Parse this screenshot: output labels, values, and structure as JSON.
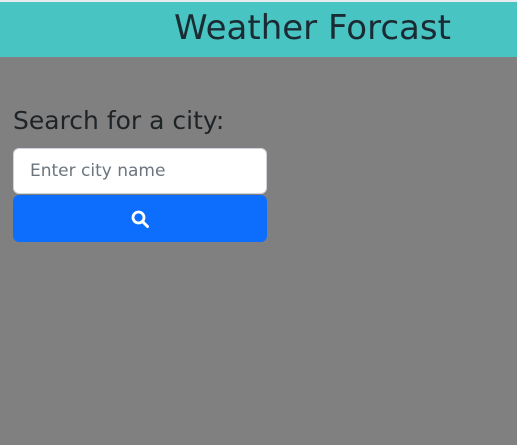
{
  "header": {
    "title": "Weather Forcast"
  },
  "search": {
    "label": "Search for a city:",
    "placeholder": "Enter city name",
    "value": "",
    "button_icon": "search-icon"
  },
  "colors": {
    "header_background": "#48c4c2",
    "page_background": "#808080",
    "button_background": "#0d6efd"
  }
}
